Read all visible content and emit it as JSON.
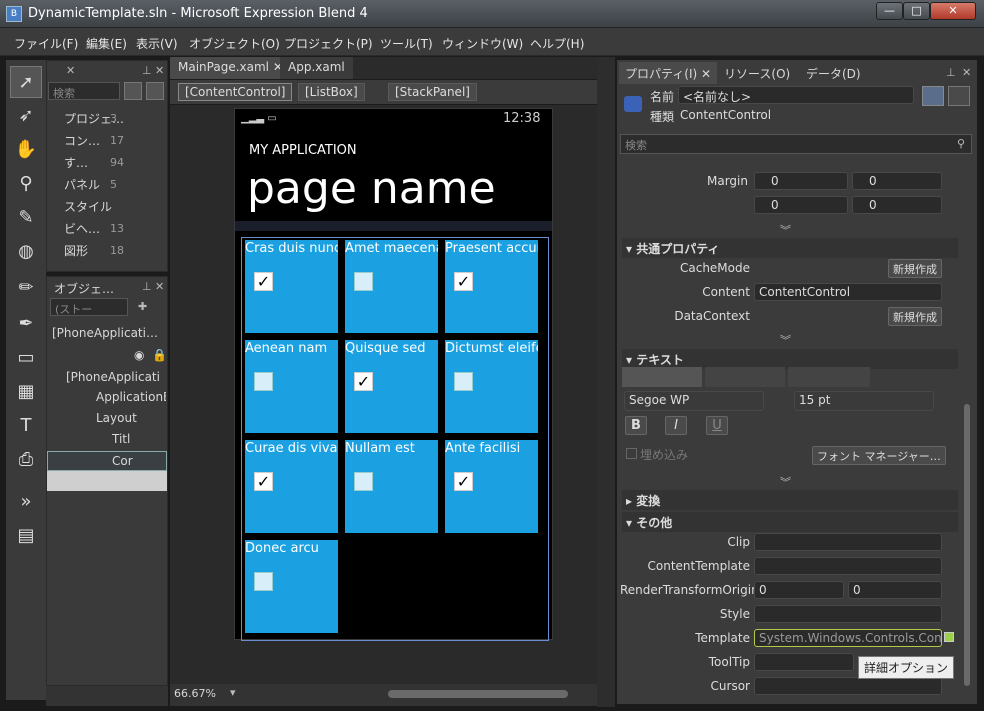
{
  "window": {
    "title": "DynamicTemplate.sln - Microsoft Expression Blend 4",
    "icon": "blend-app-icon"
  },
  "menu": [
    "ファイル(F)",
    "編集(E)",
    "表示(V)",
    "オブジェクト(O)",
    "プロジェクト(P)",
    "ツール(T)",
    "ウィンドウ(W)",
    "ヘルプ(H)"
  ],
  "assets": {
    "search_placeholder": "検索",
    "items": [
      {
        "label": "プロジェ…",
        "count": "3"
      },
      {
        "label": "コン…",
        "count": "17"
      },
      {
        "label": "す…",
        "count": "94"
      },
      {
        "label": "パネル",
        "count": "5"
      },
      {
        "label": "スタイル",
        "count": ""
      },
      {
        "label": "ビヘ…",
        "count": "13"
      },
      {
        "label": "図形",
        "count": "18"
      }
    ]
  },
  "objects": {
    "title": "オブジェ…",
    "filter_placeholder": "(ストー",
    "nodes": [
      "[PhoneApplicati…",
      "[PhoneApplicati",
      "ApplicationBa",
      "Layout",
      "Titl",
      "Cor"
    ]
  },
  "doc_tabs": [
    "MainPage.xaml",
    "App.xaml"
  ],
  "breadcrumbs": [
    "[ContentControl]",
    "[ListBox]",
    "[StackPanel]"
  ],
  "phone": {
    "time": "12:38",
    "app_title": "MY APPLICATION",
    "page_title": "page name",
    "tiles": [
      {
        "label": "Cras duis nunc",
        "checked": true
      },
      {
        "label": "Amet maecenas",
        "checked": false
      },
      {
        "label": "Praesent accum",
        "checked": true
      },
      {
        "label": "Aenean nam",
        "checked": false
      },
      {
        "label": "Quisque sed",
        "checked": true
      },
      {
        "label": "Dictumst eleifen",
        "checked": false
      },
      {
        "label": "Curae dis vivam",
        "checked": true
      },
      {
        "label": "Nullam est",
        "checked": false
      },
      {
        "label": "Ante facilisi",
        "checked": true
      },
      {
        "label": "Donec arcu",
        "checked": false
      }
    ]
  },
  "zoom": "66.67%",
  "properties": {
    "tabs": [
      "プロパティ(I)",
      "リソース(O)",
      "データ(D)"
    ],
    "name_label": "名前",
    "name_value": "<名前なし>",
    "type_label": "種類",
    "type_value": "ContentControl",
    "search_placeholder": "検索",
    "margin_label": "Margin",
    "margin": [
      "0",
      "0",
      "0",
      "0"
    ],
    "common_header": "共通プロパティ",
    "cache_mode": "CacheMode",
    "new_btn": "新規作成",
    "content_label": "Content",
    "content_value": "ContentControl",
    "datacontext": "DataContext",
    "text_header": "テキスト",
    "font": "Segoe WP",
    "size": "15 pt",
    "bold": "B",
    "italic": "I",
    "underline": "U",
    "embed": "埋め込み",
    "font_manager": "フォント マネージャー…",
    "transform_header": "変換",
    "other_header": "その他",
    "clip": "Clip",
    "content_template": "ContentTemplate",
    "rto": "RenderTransformOrigin",
    "rto_values": [
      "0",
      "0"
    ],
    "style": "Style",
    "template": "Template",
    "template_value": "System.Windows.Controls.Con…",
    "tooltip": "ToolTip",
    "cursor": "Cursor",
    "tooltip_popup": "詳細オプション"
  }
}
